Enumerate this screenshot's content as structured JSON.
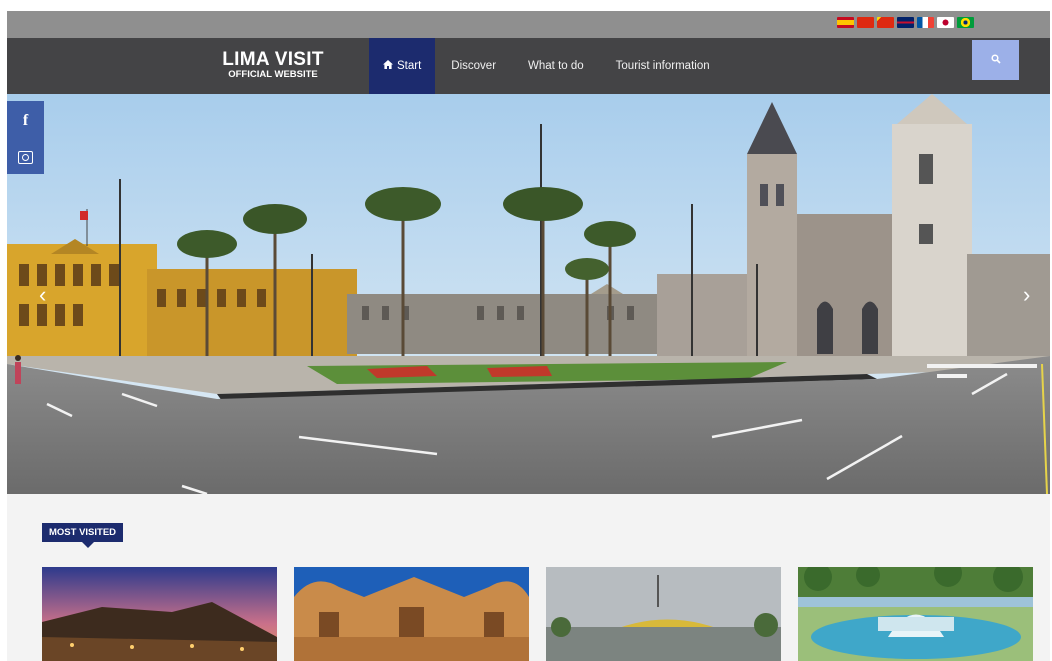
{
  "topbar": {
    "flags": [
      {
        "icon": "spain-flag-icon",
        "colors": [
          "#c60b1e",
          "#ffc400",
          "#c60b1e"
        ]
      },
      {
        "icon": "china-flag-icon",
        "colors": [
          "#de2910",
          "#de2910",
          "#de2910"
        ]
      },
      {
        "icon": "china-flag-icon",
        "colors": [
          "#de2910",
          "#ffde00",
          "#de2910"
        ]
      },
      {
        "icon": "uk-flag-icon",
        "colors": [
          "#012169",
          "#c8102e",
          "#ffffff"
        ]
      },
      {
        "icon": "france-flag-icon",
        "colors": [
          "#0055a4",
          "#ffffff",
          "#ef4135"
        ]
      },
      {
        "icon": "japan-flag-icon",
        "colors": [
          "#ffffff",
          "#bc002d",
          "#ffffff"
        ]
      },
      {
        "icon": "brazil-flag-icon",
        "colors": [
          "#009c3b",
          "#ffdf00",
          "#002776"
        ]
      }
    ]
  },
  "header": {
    "logo_line1": "LIMA VISIT",
    "logo_line2": "OFFICIAL WEBSITE",
    "nav": [
      {
        "label": "Start",
        "active": true,
        "icon": "home-icon"
      },
      {
        "label": "Discover",
        "active": false
      },
      {
        "label": "What to do",
        "active": false
      },
      {
        "label": "Tourist information",
        "active": false
      }
    ],
    "search_icon": "search-icon"
  },
  "social": {
    "facebook": "f",
    "icons": [
      "facebook-icon",
      "instagram-icon"
    ]
  },
  "hero": {
    "prev_arrow": "‹",
    "next_arrow": "›"
  },
  "section": {
    "title": "MOST VISITED"
  },
  "cards": [
    {
      "name": "card-huaca"
    },
    {
      "name": "card-church"
    },
    {
      "name": "card-arch"
    },
    {
      "name": "card-fountain"
    }
  ],
  "colors": {
    "accent": "#1c2b6e",
    "nav_bg": "#444446",
    "topbar_bg": "#8f8f8f",
    "search_bg": "#9cb0e8",
    "social_bg": "#3e5ea8"
  }
}
